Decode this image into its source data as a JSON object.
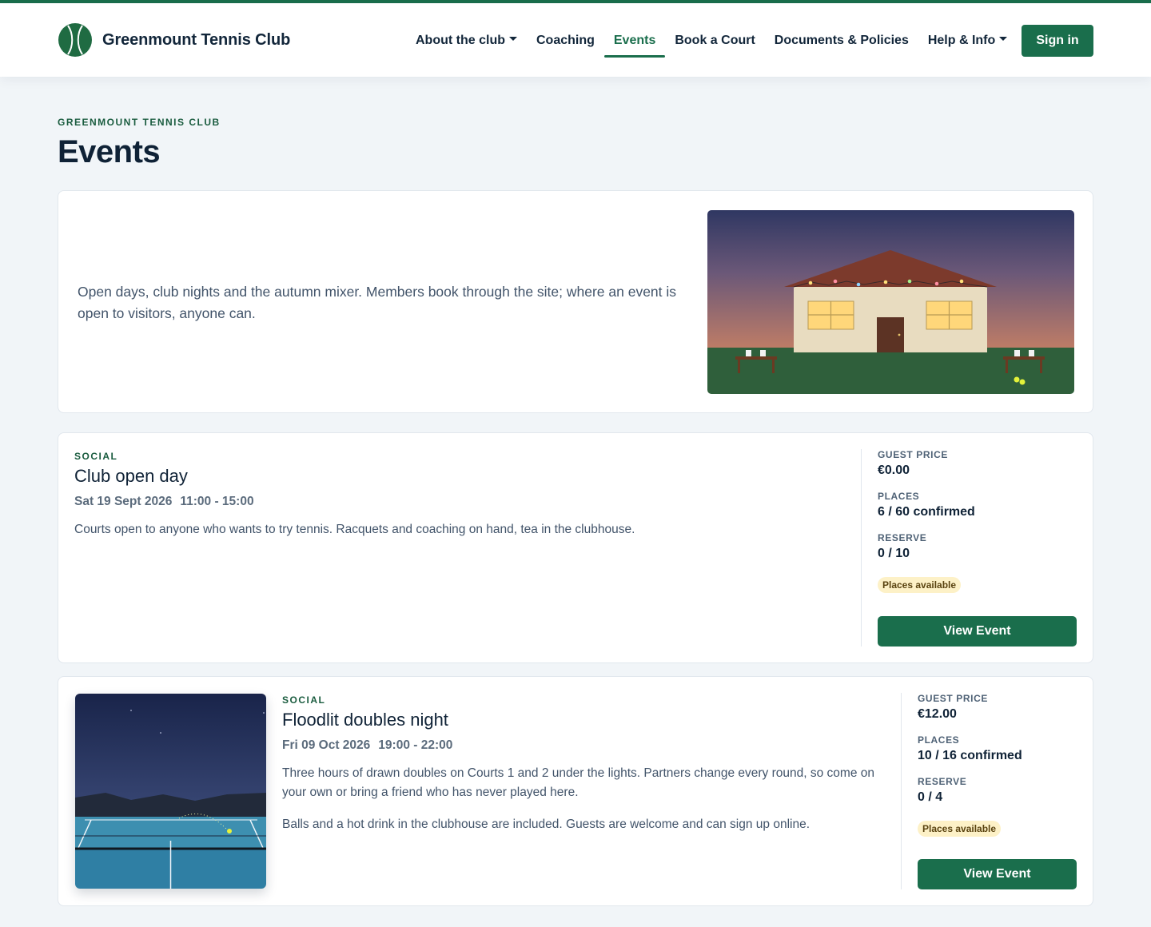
{
  "brand": {
    "name": "Greenmount Tennis Club",
    "logo_icon": "tennis-ball-icon"
  },
  "nav": {
    "items": [
      {
        "label": "About the club",
        "dropdown": true,
        "active": false
      },
      {
        "label": "Coaching",
        "dropdown": false,
        "active": false
      },
      {
        "label": "Events",
        "dropdown": false,
        "active": true
      },
      {
        "label": "Book a Court",
        "dropdown": false,
        "active": false
      },
      {
        "label": "Documents & Policies",
        "dropdown": false,
        "active": false
      },
      {
        "label": "Help & Info",
        "dropdown": true,
        "active": false
      }
    ],
    "signin_label": "Sign in"
  },
  "page": {
    "eyebrow": "GREENMOUNT TENNIS CLUB",
    "title": "Events",
    "intro": "Open days, club nights and the autumn mixer. Members book through the site; where an event is open to visitors, anyone can."
  },
  "events": [
    {
      "category": "SOCIAL",
      "title": "Club open day",
      "date": "Sat 19 Sept 2026",
      "time": "11:00 - 15:00",
      "description": [
        "Courts open to anyone who wants to try tennis. Racquets and coaching on hand, tea in the clubhouse."
      ],
      "guest_price_label": "GUEST PRICE",
      "guest_price": "€0.00",
      "places_label": "PLACES",
      "places": "6 / 60 confirmed",
      "reserve_label": "RESERVE",
      "reserve": "0 / 10",
      "status": "Places available",
      "button": "View Event"
    },
    {
      "category": "SOCIAL",
      "title": "Floodlit doubles night",
      "date": "Fri 09 Oct 2026",
      "time": "19:00 - 22:00",
      "description": [
        "Three hours of drawn doubles on Courts 1 and 2 under the lights. Partners change every round, so come on your own or bring a friend who has never played here.",
        "Balls and a hot drink in the clubhouse are included. Guests are welcome and can sign up online."
      ],
      "guest_price_label": "GUEST PRICE",
      "guest_price": "€12.00",
      "places_label": "PLACES",
      "places": "10 / 16 confirmed",
      "reserve_label": "RESERVE",
      "reserve": "0 / 4",
      "status": "Places available",
      "button": "View Event"
    }
  ],
  "colors": {
    "brand_green": "#1a6e4c",
    "page_bg": "#f1f5f8",
    "badge_bg": "#fdf1c7",
    "text_dark": "#0f2236"
  }
}
